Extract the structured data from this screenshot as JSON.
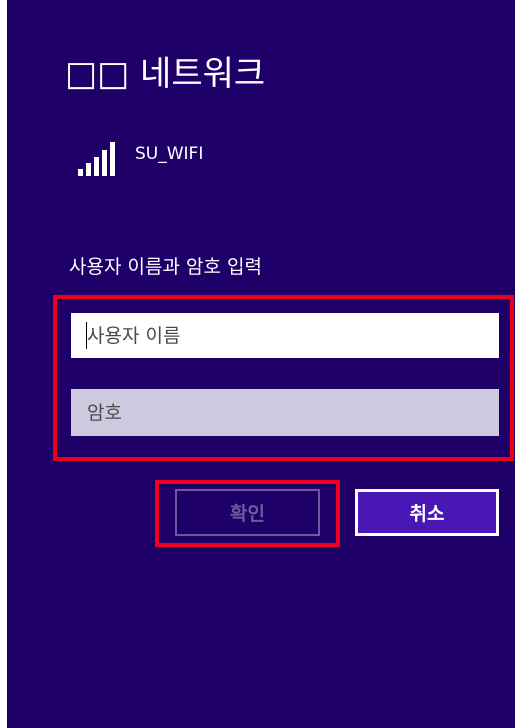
{
  "dialog": {
    "title": "□□ 네트워크",
    "network_name": "SU_WIFI",
    "signal_icon": "wifi-signal-icon",
    "prompt": "사용자 이름과 암호 입력",
    "username": {
      "value": "",
      "placeholder": "사용자 이름"
    },
    "password": {
      "value": "",
      "placeholder": "암호"
    },
    "ok_label": "확인",
    "cancel_label": "취소"
  },
  "colors": {
    "background": "#1f0068",
    "highlight": "#e8001c",
    "cancel_button": "#4a17b7",
    "password_field": "#cfc9df"
  }
}
